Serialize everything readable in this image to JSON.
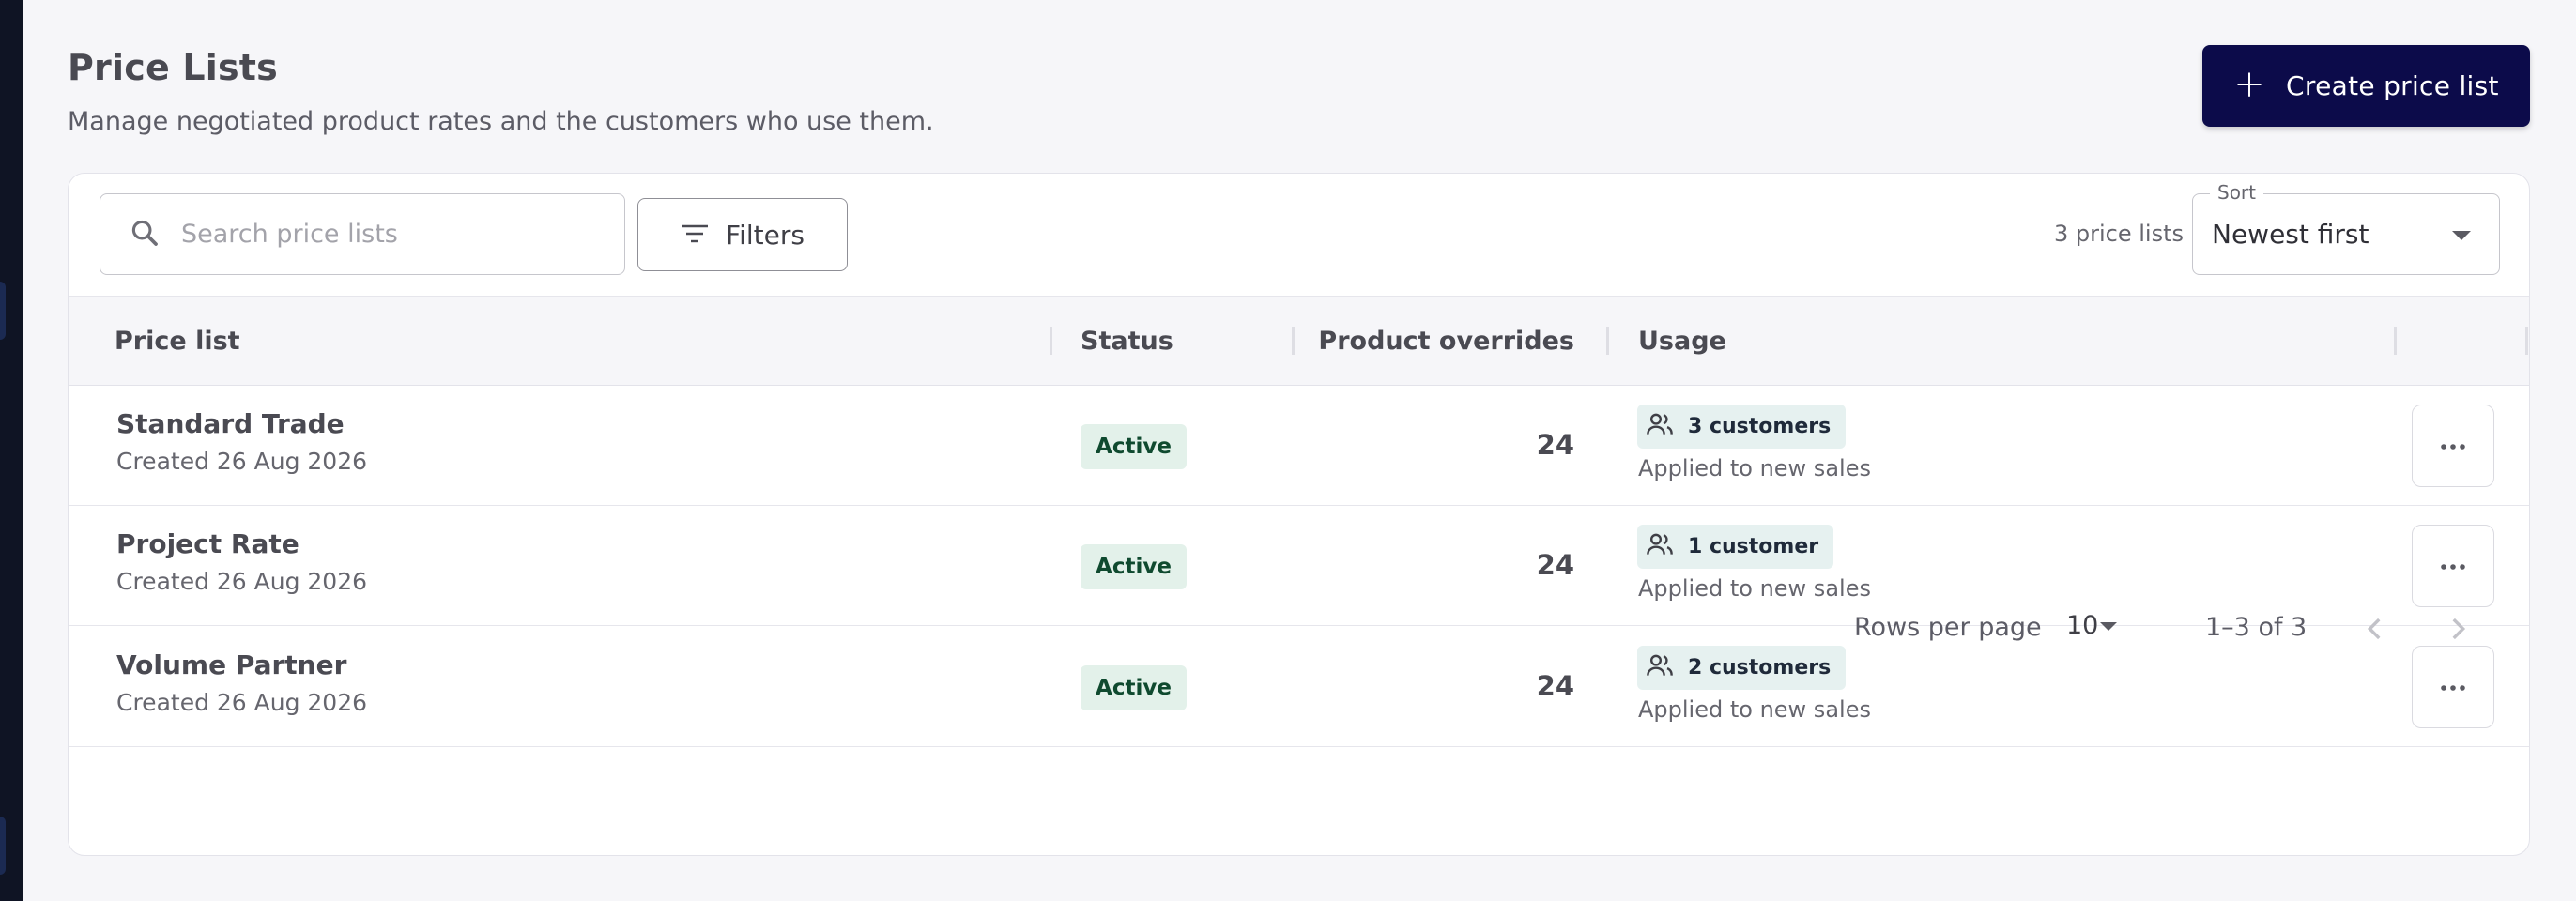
{
  "header": {
    "title": "Price Lists",
    "subtitle": "Manage negotiated product rates and the customers who use them.",
    "create_button_label": "Create price list"
  },
  "toolbar": {
    "search_placeholder": "Search price lists",
    "search_value": "",
    "filters_label": "Filters",
    "count_text": "3 price lists",
    "sort_label": "Sort",
    "sort_value": "Newest first"
  },
  "table": {
    "columns": [
      "Price list",
      "Status",
      "Product overrides",
      "Usage"
    ],
    "rows": [
      {
        "name": "Standard Trade",
        "created": "Created 26 Aug 2026",
        "status": "Active",
        "overrides": "24",
        "usage": "3 customers",
        "usage_note": "Applied to new sales"
      },
      {
        "name": "Project Rate",
        "created": "Created 26 Aug 2026",
        "status": "Active",
        "overrides": "24",
        "usage": "1 customer",
        "usage_note": "Applied to new sales"
      },
      {
        "name": "Volume Partner",
        "created": "Created 26 Aug 2026",
        "status": "Active",
        "overrides": "24",
        "usage": "2 customers",
        "usage_note": "Applied to new sales"
      }
    ]
  },
  "pagination": {
    "rows_per_page_label": "Rows per page",
    "rows_per_page_value": "10",
    "range_text": "1–3 of 3"
  },
  "icons": {
    "search": "search-icon",
    "filter": "filter-icon",
    "customers": "users-icon",
    "more": "more-horizontal-icon",
    "prev": "chevron-left-icon",
    "next": "chevron-right-icon",
    "add": "plus-icon"
  },
  "colors": {
    "primary": "#0c0b4a",
    "status_bg": "#e3f1ea",
    "status_text": "#0f4a2f",
    "usage_bg": "#e6f1f0",
    "page_bg": "#f6f6f9"
  }
}
